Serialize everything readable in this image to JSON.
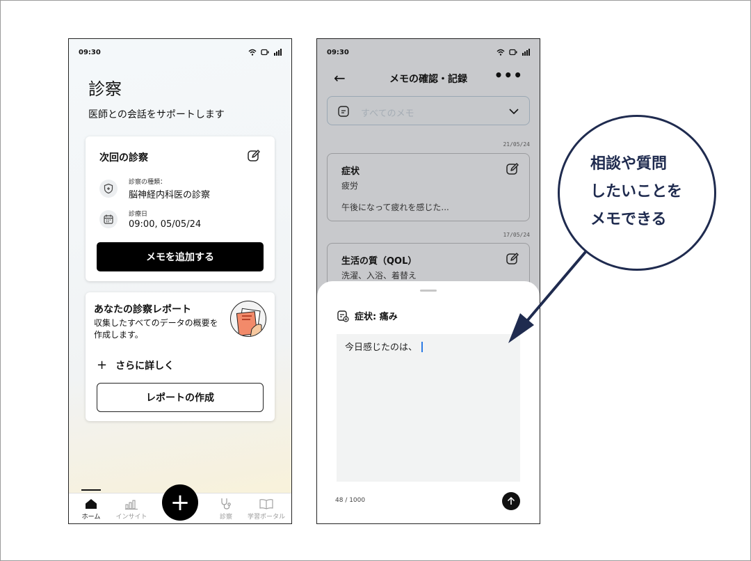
{
  "status_time": "09:30",
  "screen1": {
    "title": "診察",
    "subtitle": "医師との会話をサポートします",
    "next_visit": {
      "heading": "次回の診察",
      "type_label": "診察の種類：",
      "type_value": "脳神経内科医の診察",
      "date_label": "診療日",
      "date_value": "09:00, 05/05/24",
      "add_memo_button": "メモを追加する"
    },
    "report": {
      "title": "あなたの診察レポート",
      "description": "収集したすべてのデータの概要を作成します。",
      "more_label": "さらに詳しく",
      "create_button": "レポートの作成"
    },
    "nav": {
      "home": "ホーム",
      "insight": "インサイト",
      "consult": "診察",
      "portal": "学習ポータル",
      "fab": "+"
    }
  },
  "screen2": {
    "header_title": "メモの確認・記録",
    "back": "←",
    "more": "•••",
    "filter_placeholder": "すべてのメモ",
    "memos": [
      {
        "date": "21/05/24",
        "title": "症状",
        "subtitle": "疲労",
        "body": "午後になって疲れを感じた..."
      },
      {
        "date": "17/05/24",
        "title": "生活の質（QOL）",
        "subtitle": "洗濯、入浴、着替え"
      }
    ],
    "sheet": {
      "heading": "症状: 痛み",
      "text": "今日感じたのは、",
      "counter": "48 / 1000"
    }
  },
  "callout": {
    "text": "相談や質問\nしたいことを\nメモできる"
  },
  "colors": {
    "callout_navy": "#1f2b4f",
    "button_black": "#000000",
    "caret_blue": "#2c7be5"
  }
}
